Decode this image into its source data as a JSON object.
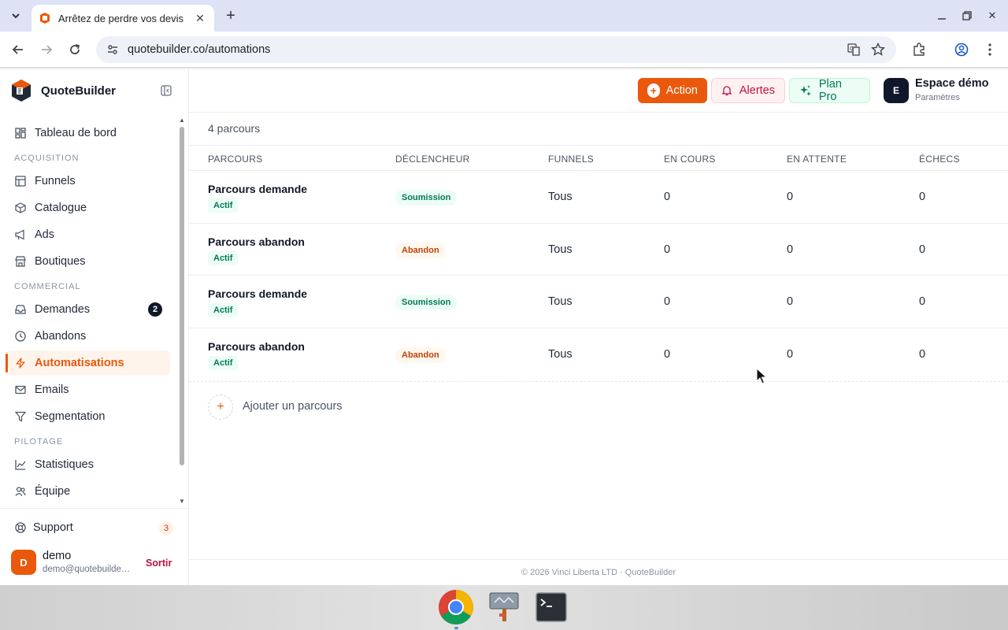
{
  "browser": {
    "tab_title": "Arrêtez de perdre vos devis",
    "url": "quotebuilder.co/automations"
  },
  "brand": {
    "name": "QuoteBuilder"
  },
  "sidebar": {
    "items": [
      {
        "label": "Tableau de bord"
      },
      {
        "section": "ACQUISITION"
      },
      {
        "label": "Funnels"
      },
      {
        "label": "Catalogue"
      },
      {
        "label": "Ads"
      },
      {
        "label": "Boutiques"
      },
      {
        "section": "COMMERCIAL"
      },
      {
        "label": "Demandes",
        "badge": "2"
      },
      {
        "label": "Abandons"
      },
      {
        "label": "Automatisations",
        "active": true
      },
      {
        "label": "Emails"
      },
      {
        "label": "Segmentation"
      },
      {
        "section": "PILOTAGE"
      },
      {
        "label": "Statistiques"
      },
      {
        "label": "Équipe"
      }
    ],
    "support": {
      "label": "Support",
      "badge": "3"
    },
    "user": {
      "initial": "D",
      "name": "demo",
      "email": "demo@quotebuilder.co",
      "logout": "Sortir"
    }
  },
  "topbar": {
    "action_label": "Action",
    "alerts_label": "Alertes",
    "plan_label": "Plan Pro",
    "workspace": {
      "initial": "E",
      "name": "Espace démo",
      "sub": "Paramètres"
    }
  },
  "main": {
    "count": "4 parcours",
    "columns": [
      "PARCOURS",
      "DÉCLENCHEUR",
      "FUNNELS",
      "EN COURS",
      "EN ATTENTE",
      "ÉCHECS"
    ],
    "rows": [
      {
        "name": "Parcours demande",
        "status": "Actif",
        "trigger": "Soumission",
        "trigger_kind": "sub",
        "funnels": "Tous",
        "en_cours": "0",
        "en_attente": "0",
        "echecs": "0"
      },
      {
        "name": "Parcours abandon",
        "status": "Actif",
        "trigger": "Abandon",
        "trigger_kind": "ab",
        "funnels": "Tous",
        "en_cours": "0",
        "en_attente": "0",
        "echecs": "0"
      },
      {
        "name": "Parcours demande",
        "status": "Actif",
        "trigger": "Soumission",
        "trigger_kind": "sub",
        "funnels": "Tous",
        "en_cours": "0",
        "en_attente": "0",
        "echecs": "0"
      },
      {
        "name": "Parcours abandon",
        "status": "Actif",
        "trigger": "Abandon",
        "trigger_kind": "ab",
        "funnels": "Tous",
        "en_cours": "0",
        "en_attente": "0",
        "echecs": "0"
      }
    ],
    "add_label": "Ajouter un parcours",
    "footer": "© 2026 Vinci Liberta LTD · QuoteBuilder"
  },
  "colors": {
    "accent": "#ea580c",
    "success": "#047857",
    "danger": "#be123c"
  }
}
